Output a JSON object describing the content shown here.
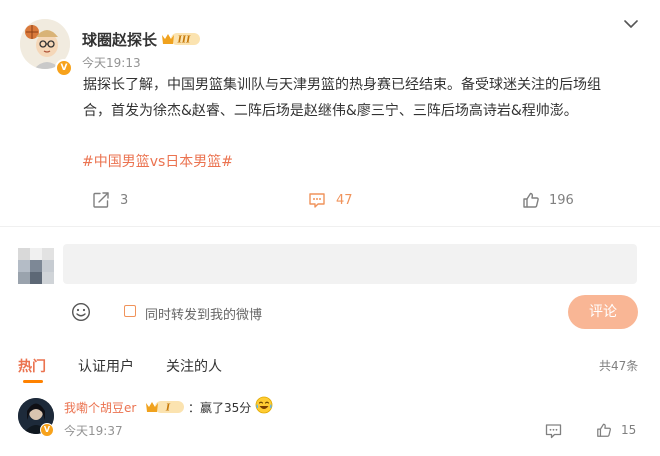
{
  "post": {
    "author": "球圈赵探长",
    "member_level": "III",
    "time": "今天19:13",
    "text": "据探长了解，中国男篮集训队与天津男篮的热身赛已经结束。备受球迷关注的后场组合，首发为徐杰&赵睿、二阵后场是赵继伟&廖三宁、三阵后场高诗岩&程帅澎。",
    "hashtag": "#中国男篮vs日本男篮#",
    "reposts": "3",
    "comments": "47",
    "likes": "196"
  },
  "composer": {
    "input_value": "",
    "repost_check_label": "同时转发到我的微博",
    "submit_label": "评论"
  },
  "comments_section": {
    "tabs": [
      {
        "label": "热门",
        "active": true
      },
      {
        "label": "认证用户",
        "active": false
      },
      {
        "label": "关注的人",
        "active": false
      }
    ],
    "total": "共47条"
  },
  "comments": [
    {
      "user": "我嘞个胡豆er",
      "member_level": "I",
      "text": "：赢了35分",
      "emoji": "laughing-tears",
      "time": "今天19:37",
      "likes": "15"
    }
  ],
  "icons": {
    "menu": "chevron-down-icon",
    "repost": "repost-icon",
    "comment": "comment-icon",
    "like": "thumbs-up-icon",
    "emoji": "smiley-icon",
    "verified": "verified-v-icon"
  },
  "colors": {
    "accent": "#eb7350",
    "verified": "#f7a21b",
    "submit_disabled": "#f9b695",
    "tab_underline": "#ff8200"
  }
}
